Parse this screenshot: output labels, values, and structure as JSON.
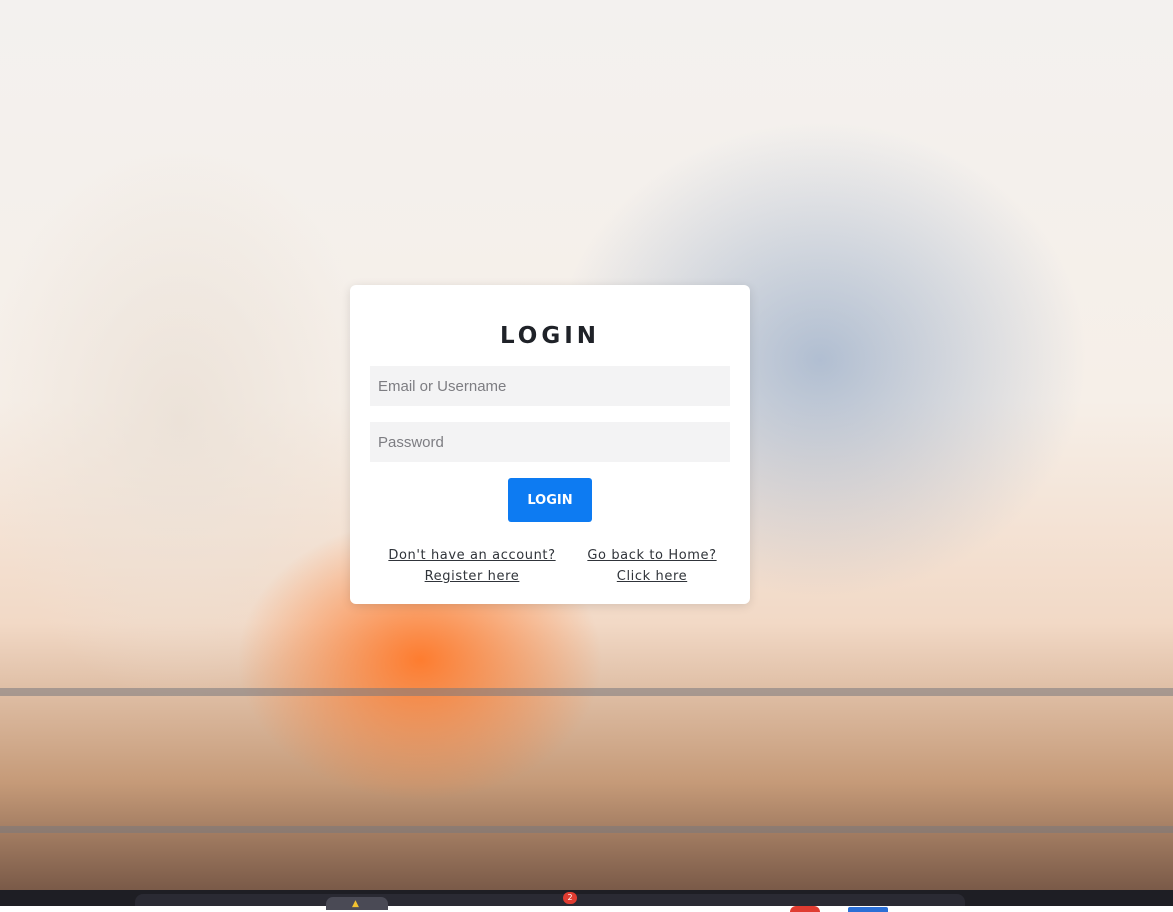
{
  "login": {
    "title": "LOGIN",
    "username_placeholder": "Email or Username",
    "password_placeholder": "Password",
    "submit_label": "LOGIN",
    "register_prompt": "Don't have an account?",
    "register_link": "Register here",
    "home_prompt": "Go back to Home?",
    "home_link": "Click here"
  },
  "taskbar": {
    "badge_count": "2"
  },
  "colors": {
    "primary_button": "#0d7bf2",
    "card_background": "#ffffff",
    "input_background": "#f3f3f4"
  }
}
